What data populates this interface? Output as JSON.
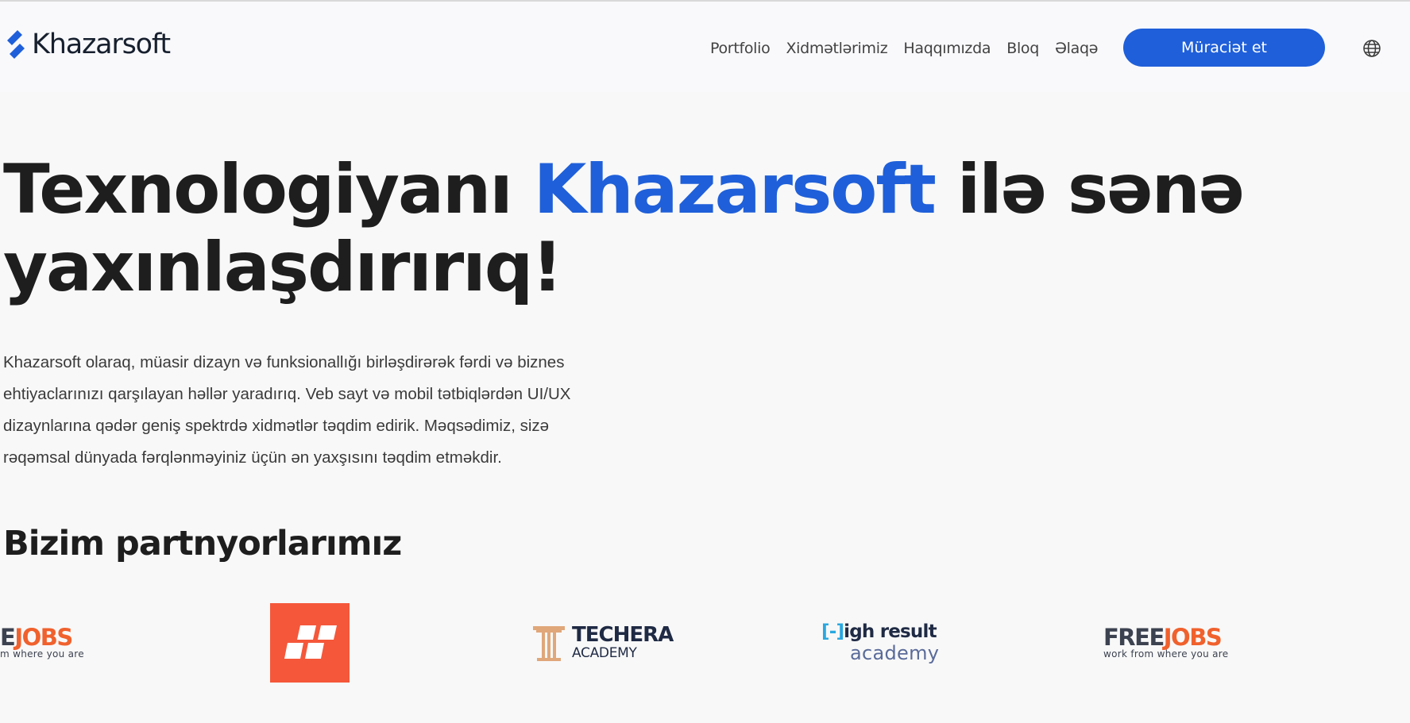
{
  "brand": {
    "name": "Khazarsoft",
    "accent_color": "#1f5fd9"
  },
  "nav": {
    "items": [
      "Portfolio",
      "Xidmətlərimiz",
      "Haqqımızda",
      "Bloq",
      "Əlaqə"
    ],
    "cta_label": "Müraciət et",
    "language_icon": "globe-icon"
  },
  "hero": {
    "title_before": "Texnologiyanı ",
    "title_accent": "Khazarsoft",
    "title_after": " ilə sənə yaxınlaşdırırıq!",
    "description": "Khazarsoft olaraq, müasir dizayn və funksionallığı birləşdirərək fərdi və biznes ehtiyaclarınızı qarşılayan həllər yaradırıq. Veb sayt və mobil tətbiqlərdən UI/UX dizaynlarına qədər geniş spektrdə xidmətlər təqdim edirik. Məqsədimiz, sizə rəqəmsal dünyada fərqlənməyiniz üçün ən yaxşısını təqdim etməkdir."
  },
  "partners": {
    "heading": "Bizim partnyorlarımız",
    "logos": {
      "freejobs": {
        "part1": "FREE",
        "part2": "JOBS",
        "tagline": "work from where you are"
      },
      "freejobs_partial": {
        "part1": "E",
        "part2": "JOBS",
        "tagline": "m where you are"
      },
      "techera": {
        "line1": "TECHERA",
        "line2": "ACADEMY"
      },
      "highresult": {
        "bracket": "[-]",
        "line1": "igh result",
        "line2": "academy"
      },
      "orange_brand": {
        "bg_color": "#f5573a"
      }
    }
  }
}
